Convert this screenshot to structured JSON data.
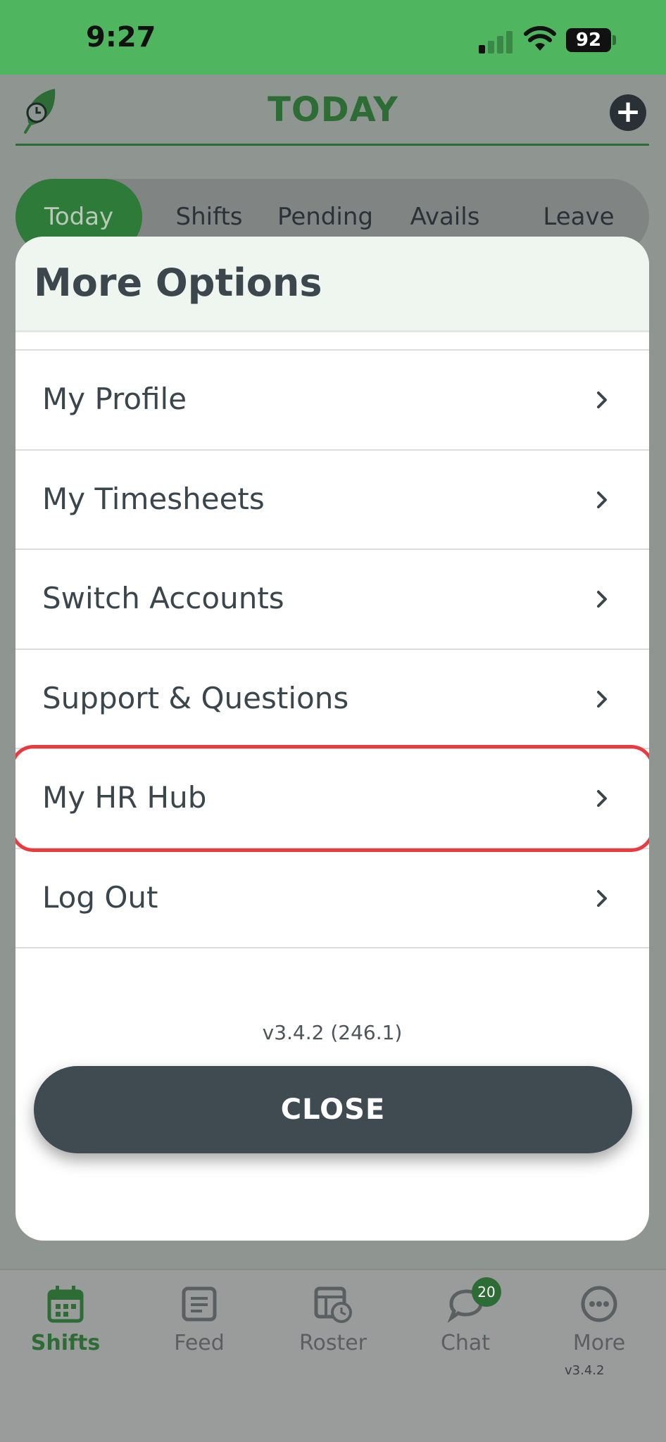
{
  "status_bar": {
    "time": "9:27",
    "battery": "92",
    "icons": [
      "signal-icon",
      "wifi-icon",
      "battery-icon"
    ]
  },
  "header": {
    "title": "TODAY",
    "logo_icon": "leaf-clock-icon",
    "add_icon": "plus-circle-icon"
  },
  "tabs": [
    {
      "label": "Today",
      "active": true
    },
    {
      "label": "Shifts",
      "active": false
    },
    {
      "label": "Pending",
      "active": false
    },
    {
      "label": "Avails",
      "active": false
    },
    {
      "label": "Leave",
      "active": false
    }
  ],
  "modal": {
    "title": "More Options",
    "items": [
      {
        "label": "My Profile",
        "highlighted": false
      },
      {
        "label": "My Timesheets",
        "highlighted": false
      },
      {
        "label": "Switch Accounts",
        "highlighted": false
      },
      {
        "label": "Support & Questions",
        "highlighted": false
      },
      {
        "label": "My HR Hub",
        "highlighted": true
      },
      {
        "label": "Log Out",
        "highlighted": false
      }
    ],
    "version": "v3.4.2 (246.1)",
    "close_label": "CLOSE"
  },
  "bottom_nav": {
    "items": [
      {
        "label": "Shifts",
        "icon": "calendar-icon",
        "active": true
      },
      {
        "label": "Feed",
        "icon": "document-icon",
        "active": false
      },
      {
        "label": "Roster",
        "icon": "roster-clock-icon",
        "active": false
      },
      {
        "label": "Chat",
        "icon": "chat-bubble-icon",
        "active": false,
        "badge": "20"
      },
      {
        "label": "More",
        "icon": "more-dots-icon",
        "active": false
      }
    ],
    "version": "v3.4.2"
  },
  "colors": {
    "status_green": "#4fb55f",
    "brand_green": "#2e6c36",
    "highlight_red": "#ea3a3f",
    "button_dark": "#3f4b51"
  }
}
